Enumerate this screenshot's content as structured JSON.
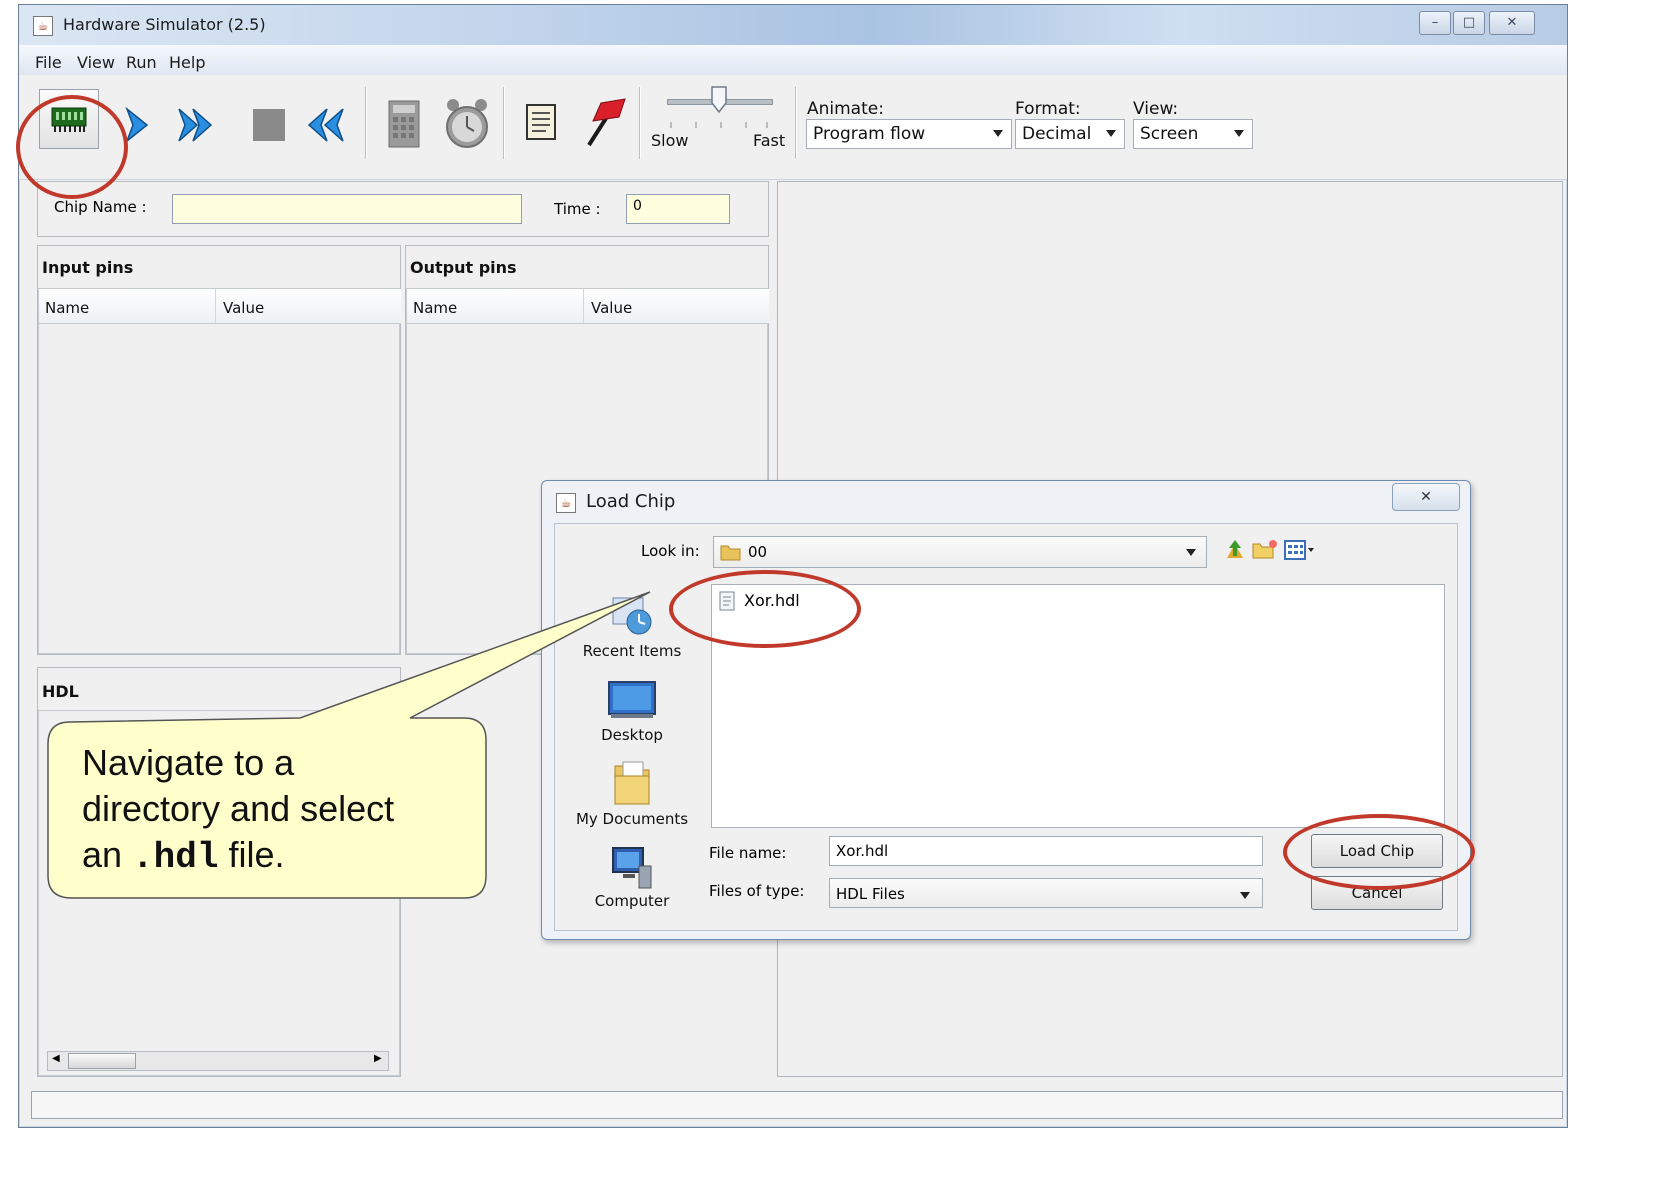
{
  "window": {
    "title": "Hardware Simulator (2.5)"
  },
  "menu": [
    "File",
    "View",
    "Run",
    "Help"
  ],
  "toolbar": {
    "speed_slow": "Slow",
    "speed_fast": "Fast",
    "animate_label": "Animate:",
    "animate_value": "Program flow",
    "format_label": "Format:",
    "format_value": "Decimal",
    "view_label": "View:",
    "view_value": "Screen"
  },
  "chip": {
    "name_label": "Chip Name :",
    "name_value": "",
    "time_label": "Time :",
    "time_value": "0"
  },
  "input_pins": {
    "title": "Input pins",
    "col_name": "Name",
    "col_value": "Value"
  },
  "output_pins": {
    "title": "Output pins",
    "col_name": "Name",
    "col_value": "Value"
  },
  "hdl": {
    "title": "HDL"
  },
  "dialog": {
    "title": "Load Chip",
    "look_in_label": "Look in:",
    "look_in_value": "00",
    "places": [
      "Recent Items",
      "Desktop",
      "My Documents",
      "Computer"
    ],
    "files": [
      "Xor.hdl"
    ],
    "file_name_label": "File name:",
    "file_name_value": "Xor.hdl",
    "file_type_label": "Files of type:",
    "file_type_value": "HDL Files",
    "load_button": "Load Chip",
    "cancel_button": "Cancel"
  },
  "callout": {
    "line1": "Navigate to a",
    "line2": "directory and select",
    "line3_pre": "an ",
    "line3_code": ".hdl",
    "line3_post": " file."
  },
  "colors": {
    "annotation_red": "#c0392b",
    "callout_fill": "#ffffcc",
    "field_yellow": "#ffffe0"
  }
}
